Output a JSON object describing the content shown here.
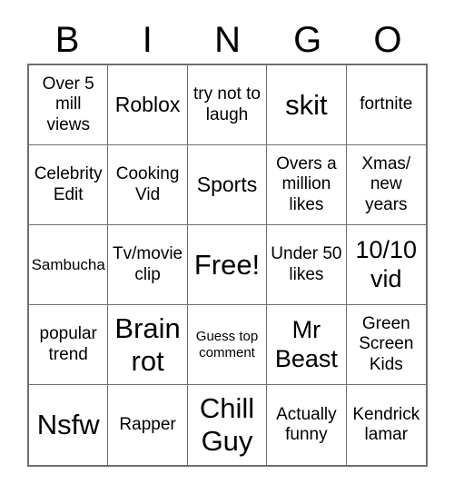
{
  "card": {
    "headers": [
      "B",
      "I",
      "N",
      "G",
      "O"
    ],
    "free_space_index": 12,
    "border_color": "#6f6f6f",
    "text_color": "#000000",
    "background_color": "#ffffff",
    "rows": [
      [
        {
          "text": "Over 5 mill views",
          "size": "md"
        },
        {
          "text": "Roblox",
          "size": "lg"
        },
        {
          "text": "try not to laugh",
          "size": "md"
        },
        {
          "text": "skit",
          "size": "xxl"
        },
        {
          "text": "fortnite",
          "size": "md"
        }
      ],
      [
        {
          "text": "Celebrity Edit",
          "size": "md"
        },
        {
          "text": "Cooking Vid",
          "size": "md"
        },
        {
          "text": "Sports",
          "size": "lg"
        },
        {
          "text": "Overs a million likes",
          "size": "md"
        },
        {
          "text": "Xmas/ new years",
          "size": "md"
        }
      ],
      [
        {
          "text": "Sambucha",
          "size": "sm"
        },
        {
          "text": "Tv/movie clip",
          "size": "md"
        },
        {
          "text": "Free!",
          "size": "xxl"
        },
        {
          "text": "Under 50 likes",
          "size": "md"
        },
        {
          "text": "10/10 vid",
          "size": "xl"
        }
      ],
      [
        {
          "text": "popular trend",
          "size": "md"
        },
        {
          "text": "Brain rot",
          "size": "xxl"
        },
        {
          "text": "Guess top comment",
          "size": "xs"
        },
        {
          "text": "Mr Beast",
          "size": "xl"
        },
        {
          "text": "Green Screen Kids",
          "size": "md"
        }
      ],
      [
        {
          "text": "Nsfw",
          "size": "xxl"
        },
        {
          "text": "Rapper",
          "size": "md"
        },
        {
          "text": "Chill Guy",
          "size": "xxl"
        },
        {
          "text": "Actually funny",
          "size": "md"
        },
        {
          "text": "Kendrick lamar",
          "size": "md"
        }
      ]
    ]
  }
}
